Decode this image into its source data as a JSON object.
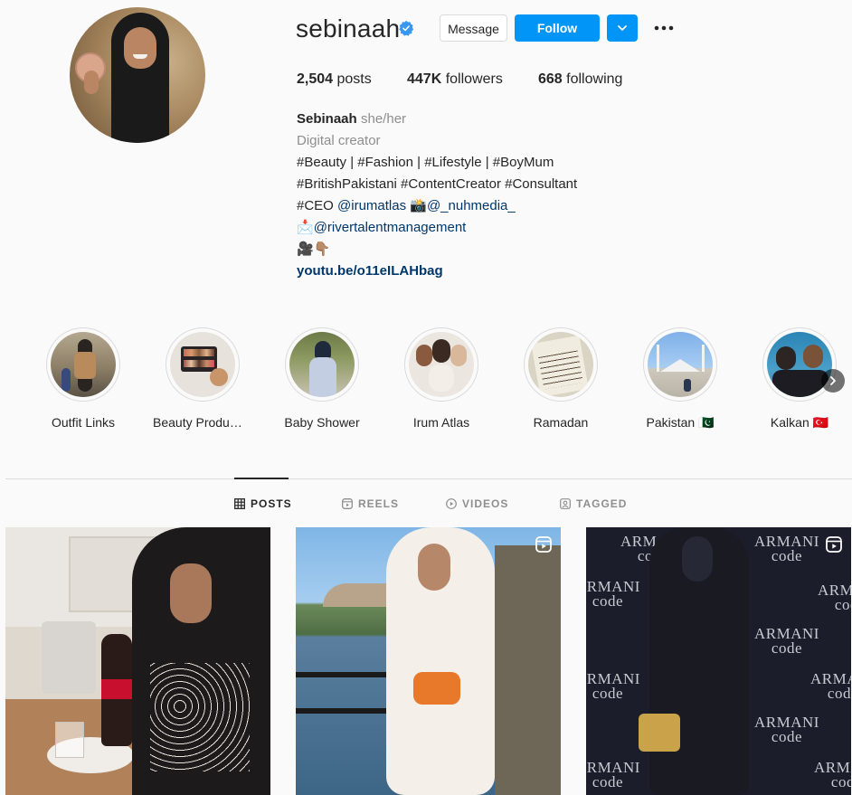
{
  "profile": {
    "username": "sebinaah",
    "verified_icon": "verified-badge-icon",
    "actions": {
      "message_label": "Message",
      "follow_label": "Follow",
      "suggest_icon": "chevron-down-icon",
      "more_icon": "more-dots-icon"
    },
    "stats": {
      "posts_count": "2,504",
      "posts_label": "posts",
      "followers_count": "447K",
      "followers_label": "followers",
      "following_count": "668",
      "following_label": "following"
    },
    "bio": {
      "name": "Sebinaah",
      "pronouns": "she/her",
      "category": "Digital creator",
      "line1": "#Beauty | #Fashion | #Lifestyle | #BoyMum",
      "line2": "#BritishPakistani #ContentCreator #Consultant",
      "line3_prefix": "#CEO ",
      "line3_mention1": "@irumatlas",
      "line3_emoji": "📸",
      "line3_mention2": "@_nuhmedia_",
      "line4_emoji": "📩",
      "line4_mention": "@rivertalentmanagement",
      "line5_emoji": "🎥👇🏽",
      "link": "youtu.be/o11eILAHbag"
    }
  },
  "highlights": [
    {
      "label": "Outfit Links"
    },
    {
      "label": "Beauty Products"
    },
    {
      "label": "Baby Shower"
    },
    {
      "label": "Irum Atlas"
    },
    {
      "label": "Ramadan"
    },
    {
      "label": "Pakistan 🇵🇰"
    },
    {
      "label": "Kalkan 🇹🇷"
    }
  ],
  "highlights_next_icon": "chevron-right-icon",
  "tabs": [
    {
      "label": "POSTS",
      "icon": "grid-icon",
      "active": true
    },
    {
      "label": "REELS",
      "icon": "reels-icon",
      "active": false
    },
    {
      "label": "VIDEOS",
      "icon": "play-icon",
      "active": false
    },
    {
      "label": "TAGGED",
      "icon": "tagged-icon",
      "active": false
    }
  ],
  "posts": [
    {
      "type": "photo"
    },
    {
      "type": "reel",
      "badge_icon": "reels-icon"
    },
    {
      "type": "reel",
      "badge_icon": "reels-icon",
      "backdrop_text": "ARMANI code"
    }
  ],
  "colors": {
    "accent": "#0095f6",
    "link": "#00376b",
    "muted": "#8e8e8e",
    "background": "#fafafa"
  }
}
